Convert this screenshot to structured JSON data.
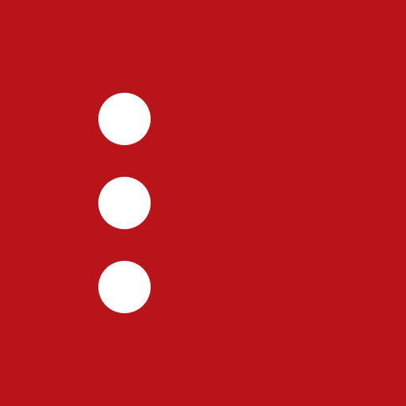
{
  "icon": {
    "name": "vertical-dots-menu-icon",
    "background_color": "#b91419",
    "dot_color": "#ffffff",
    "dot_count": 3
  }
}
